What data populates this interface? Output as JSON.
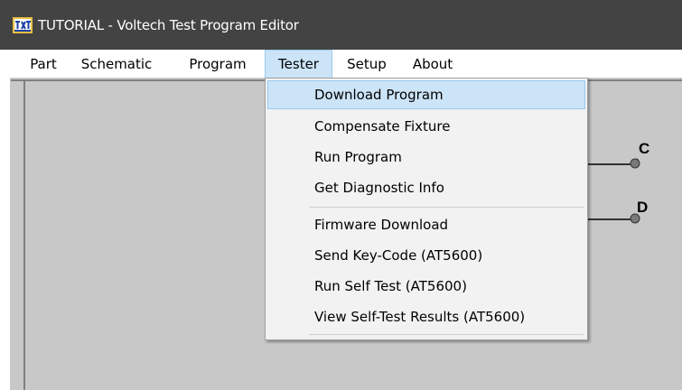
{
  "window": {
    "title": "TUTORIAL - Voltech Test Program Editor",
    "icon": "app-logo-icon"
  },
  "menubar": {
    "items": [
      {
        "label": "Part"
      },
      {
        "label": "Schematic"
      },
      {
        "label": "Program"
      },
      {
        "label": "Tester"
      },
      {
        "label": "Setup"
      },
      {
        "label": "About"
      }
    ],
    "active": "Tester"
  },
  "tester_menu": {
    "groups": [
      [
        {
          "label": "Download Program",
          "highlighted": true
        },
        {
          "label": "Compensate Fixture"
        },
        {
          "label": "Run Program"
        },
        {
          "label": "Get Diagnostic Info"
        }
      ],
      [
        {
          "label": "Firmware Download"
        },
        {
          "label": "Send Key-Code (AT5600)"
        },
        {
          "label": "Run Self Test (AT5600)"
        },
        {
          "label": "View Self-Test Results (AT5600)"
        }
      ]
    ]
  },
  "schematic": {
    "terminals": [
      {
        "label": "C"
      },
      {
        "label": "D"
      }
    ]
  },
  "colors": {
    "titlebar": "#434343",
    "workspace": "#c8c8c8",
    "menu_highlight": "#cce4f7",
    "menu_highlight_border": "#99c9ef"
  }
}
